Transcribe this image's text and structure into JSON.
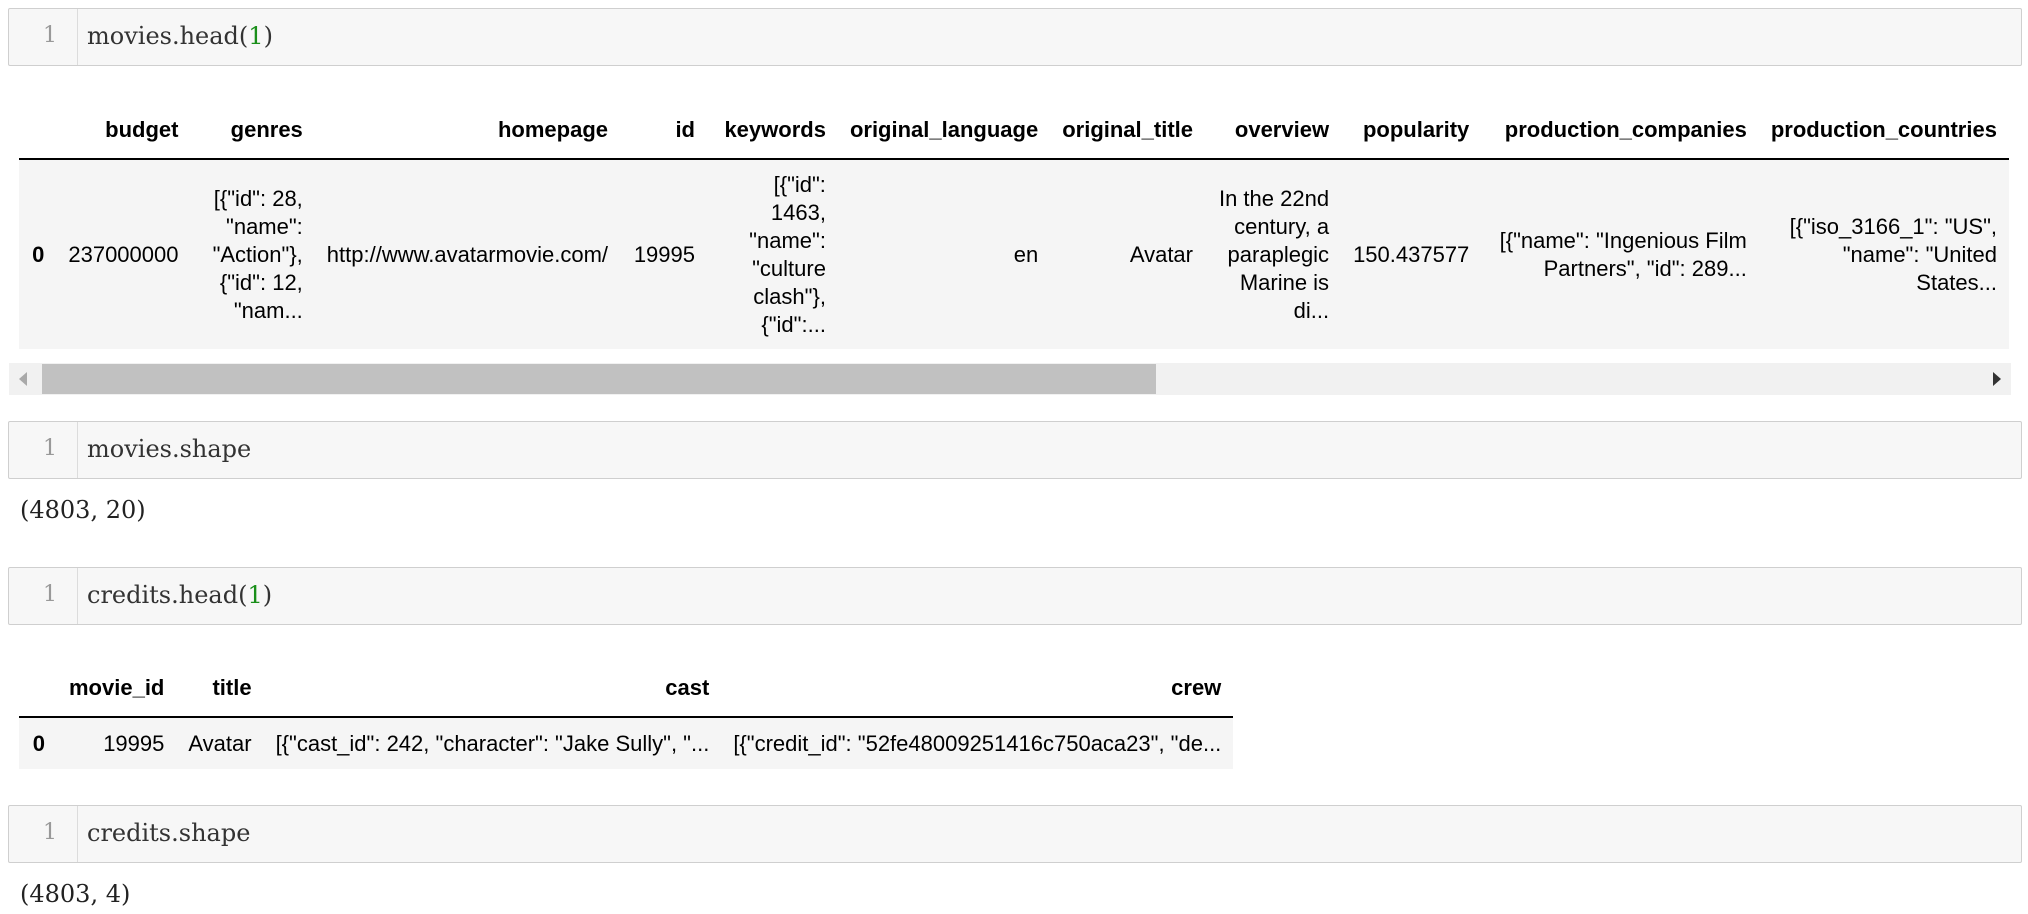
{
  "cells": [
    {
      "line": "1",
      "code_text": "movies.head(",
      "code_arg": "1",
      "code_close": ")"
    },
    {
      "line": "1",
      "code_text": "movies.shape"
    },
    {
      "line": "1",
      "code_text": "credits.head(",
      "code_arg": "1",
      "code_close": ")"
    },
    {
      "line": "1",
      "code_text": "credits.shape"
    }
  ],
  "movies_table": {
    "headers": [
      "",
      "budget",
      "genres",
      "homepage",
      "id",
      "keywords",
      "original_language",
      "original_title",
      "overview",
      "popularity",
      "production_companies",
      "production_countries"
    ],
    "row": {
      "index": "0",
      "budget": "237000000",
      "genres": "[{\"id\": 28, \"name\": \"Action\"}, {\"id\": 12, \"nam...",
      "homepage": "http://www.avatarmovie.com/",
      "id": "19995",
      "keywords": "[{\"id\": 1463, \"name\": \"culture clash\"}, {\"id\":...",
      "original_language": "en",
      "original_title": "Avatar",
      "overview": "In the 22nd century, a paraplegic Marine is di...",
      "popularity": "150.437577",
      "production_companies": "[{\"name\": \"Ingenious Film Partners\", \"id\": 289...",
      "production_countries": "[{\"iso_3166_1\": \"US\", \"name\": \"United States..."
    }
  },
  "movies_shape": "(4803, 20)",
  "credits_table": {
    "headers": [
      "",
      "movie_id",
      "title",
      "cast",
      "crew"
    ],
    "row": {
      "index": "0",
      "movie_id": "19995",
      "title": "Avatar",
      "cast": "[{\"cast_id\": 242, \"character\": \"Jake Sully\", \"...",
      "crew": "[{\"credit_id\": \"52fe48009251416c750aca23\", \"de..."
    }
  },
  "credits_shape": "(4803, 4)",
  "scrollbar": {
    "position_fraction": 0.0,
    "visible_fraction": 0.55
  }
}
